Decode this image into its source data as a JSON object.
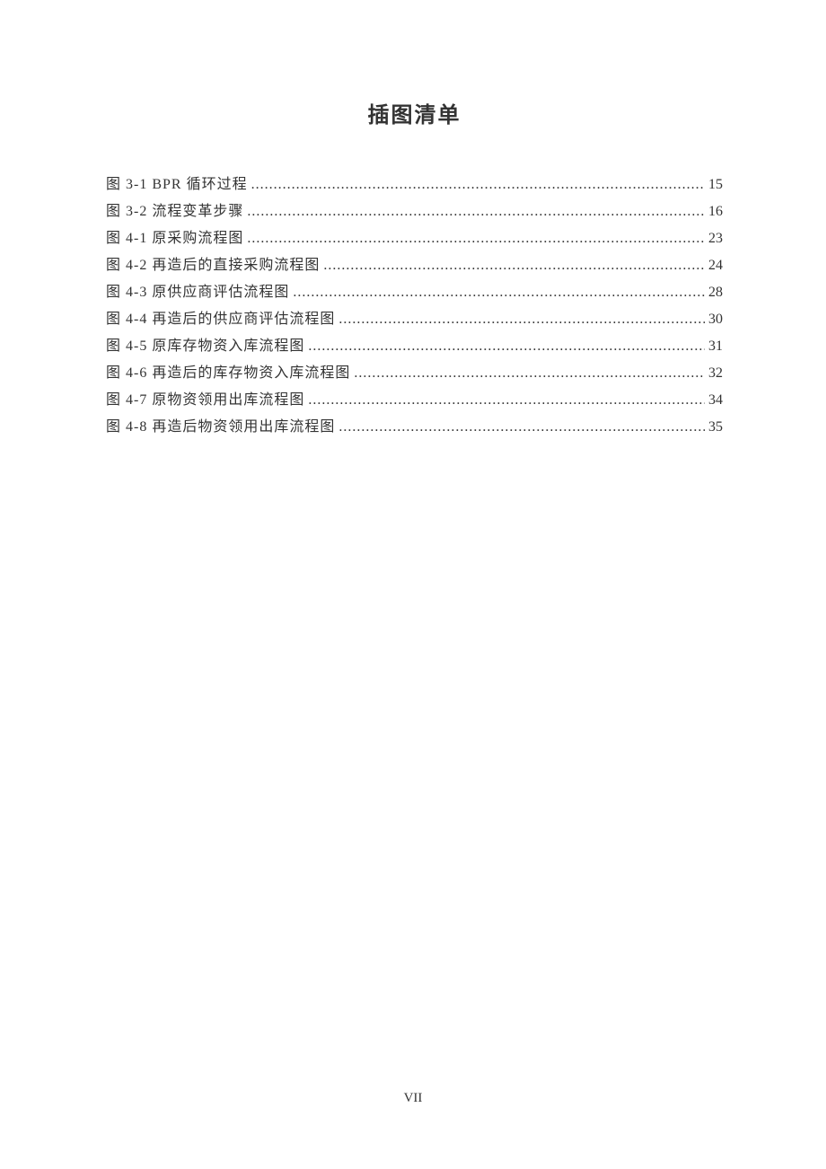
{
  "title": "插图清单",
  "entries": [
    {
      "label": "图 3-1  BPR 循环过程",
      "page": "15"
    },
    {
      "label": "图 3-2  流程变革步骤",
      "page": "16"
    },
    {
      "label": "图 4-1  原采购流程图",
      "page": "23"
    },
    {
      "label": "图 4-2  再造后的直接采购流程图",
      "page": "24"
    },
    {
      "label": "图 4-3  原供应商评估流程图",
      "page": "28"
    },
    {
      "label": "图 4-4  再造后的供应商评估流程图",
      "page": "30"
    },
    {
      "label": "图 4-5  原库存物资入库流程图",
      "page": "31"
    },
    {
      "label": "图 4-6  再造后的库存物资入库流程图",
      "page": "32"
    },
    {
      "label": "图 4-7  原物资领用出库流程图",
      "page": "34"
    },
    {
      "label": "图 4-8  再造后物资领用出库流程图",
      "page": "35"
    }
  ],
  "pageNumber": "VII"
}
